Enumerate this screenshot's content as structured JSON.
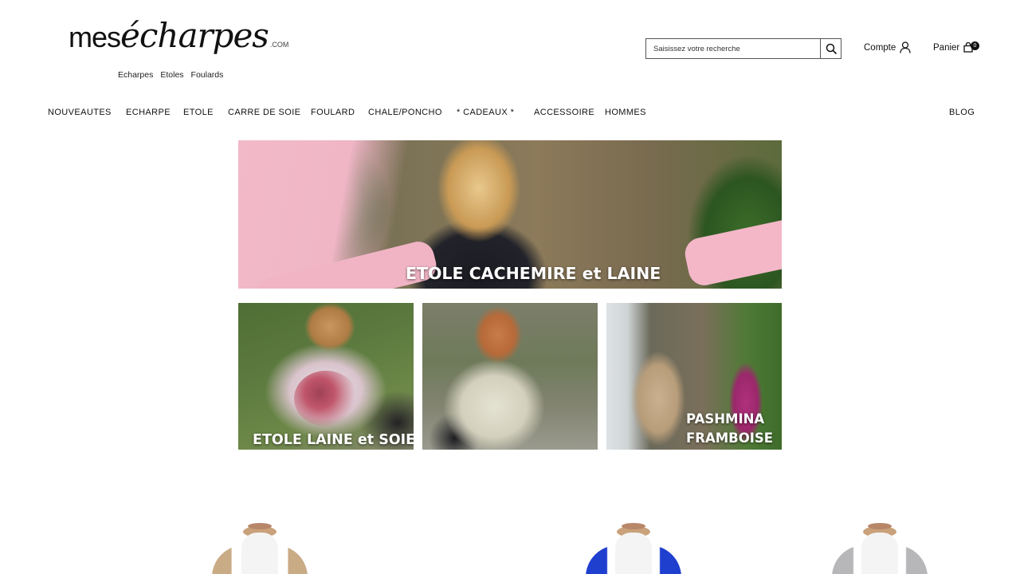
{
  "header": {
    "logo": {
      "mes": "mes",
      "echarpes": "écharpes",
      "com": ".COM"
    },
    "tagline": [
      "Echarpes",
      "Etoles",
      "Foulards"
    ],
    "search": {
      "placeholder": "Saisissez votre recherche"
    },
    "account_label": "Compte",
    "cart_label": "Panier",
    "cart_count": "0"
  },
  "nav": {
    "items": [
      "NOUVEAUTES",
      "ECHARPE",
      "ETOLE",
      "CARRE DE SOIE",
      "FOULARD",
      "CHALE/PONCHO",
      "* CADEAUX *",
      "ACCESSOIRE",
      "HOMMES"
    ],
    "blog": "BLOG"
  },
  "banners": {
    "main": "ETOLE CACHEMIRE et LAINE",
    "tile1": "ETOLE LAINE et SOIE",
    "tile3_line1": "PASHMINA",
    "tile3_line2": "FRAMBOISE"
  },
  "products": {
    "scarf_colors": [
      "#c9ab86",
      "#1f3fcf",
      "#b7b7b9"
    ]
  },
  "icons": {
    "search": "magnifier-icon",
    "account": "user-icon",
    "cart": "shopping-bag-icon"
  }
}
